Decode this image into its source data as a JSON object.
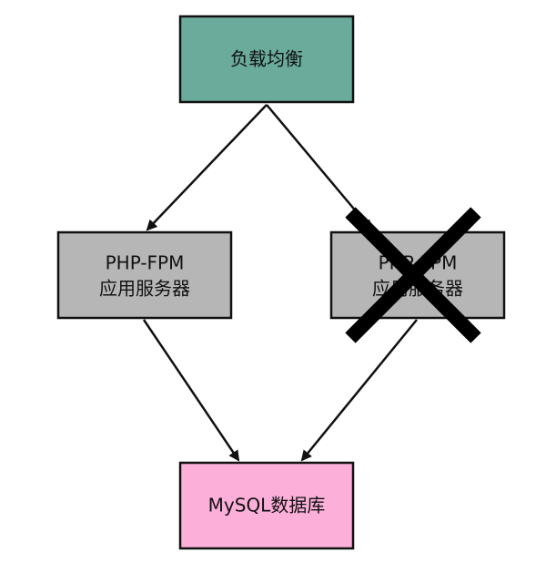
{
  "diagram": {
    "nodes": {
      "load_balancer": {
        "label": "负载均衡",
        "fill": "#6aab9c"
      },
      "server_left": {
        "line1": "PHP-FPM",
        "line2": "应用服务器",
        "fill": "#b6b6b6"
      },
      "server_right": {
        "line1": "PHP-FPM",
        "line2": "应用服务器",
        "fill": "#b6b6b6",
        "status": "failed"
      },
      "database": {
        "label": "MySQL数据库",
        "fill": "#fbafd9"
      }
    },
    "colors": {
      "stroke": "#111111",
      "cross_mark": "#000000",
      "background": "#ffffff"
    }
  }
}
